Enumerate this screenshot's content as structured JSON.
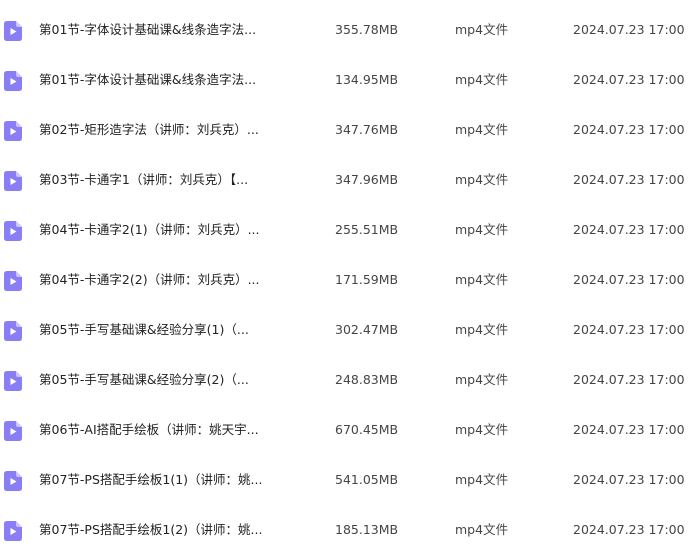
{
  "colors": {
    "icon_fill": "#8a7ef7",
    "icon_glyph": "#ffffff"
  },
  "files": [
    {
      "name": "第01节-字体设计基础课&线条造字法...",
      "size": "355.78MB",
      "type": "mp4文件",
      "date": "2024.07.23 17:00",
      "icon": "video-file-icon"
    },
    {
      "name": "第01节-字体设计基础课&线条造字法...",
      "size": "134.95MB",
      "type": "mp4文件",
      "date": "2024.07.23 17:00",
      "icon": "video-file-icon"
    },
    {
      "name": "第02节-矩形造字法（讲师：刘兵克）...",
      "size": "347.76MB",
      "type": "mp4文件",
      "date": "2024.07.23 17:00",
      "icon": "video-file-icon"
    },
    {
      "name": "第03节-卡通字1（讲师：刘兵克）【...",
      "size": "347.96MB",
      "type": "mp4文件",
      "date": "2024.07.23 17:00",
      "icon": "video-file-icon"
    },
    {
      "name": "第04节-卡通字2(1)（讲师：刘兵克）...",
      "size": "255.51MB",
      "type": "mp4文件",
      "date": "2024.07.23 17:00",
      "icon": "video-file-icon"
    },
    {
      "name": "第04节-卡通字2(2)（讲师：刘兵克）...",
      "size": "171.59MB",
      "type": "mp4文件",
      "date": "2024.07.23 17:00",
      "icon": "video-file-icon"
    },
    {
      "name": "第05节-手写基础课&经验分享(1)（...",
      "size": "302.47MB",
      "type": "mp4文件",
      "date": "2024.07.23 17:00",
      "icon": "video-file-icon"
    },
    {
      "name": "第05节-手写基础课&经验分享(2)（...",
      "size": "248.83MB",
      "type": "mp4文件",
      "date": "2024.07.23 17:00",
      "icon": "video-file-icon"
    },
    {
      "name": "第06节-AI搭配手绘板（讲师：姚天宇...",
      "size": "670.45MB",
      "type": "mp4文件",
      "date": "2024.07.23 17:00",
      "icon": "video-file-icon"
    },
    {
      "name": "第07节-PS搭配手绘板1(1)（讲师：姚...",
      "size": "541.05MB",
      "type": "mp4文件",
      "date": "2024.07.23 17:00",
      "icon": "video-file-icon"
    },
    {
      "name": "第07节-PS搭配手绘板1(2)（讲师：姚...",
      "size": "185.13MB",
      "type": "mp4文件",
      "date": "2024.07.23 17:00",
      "icon": "video-file-icon"
    }
  ]
}
